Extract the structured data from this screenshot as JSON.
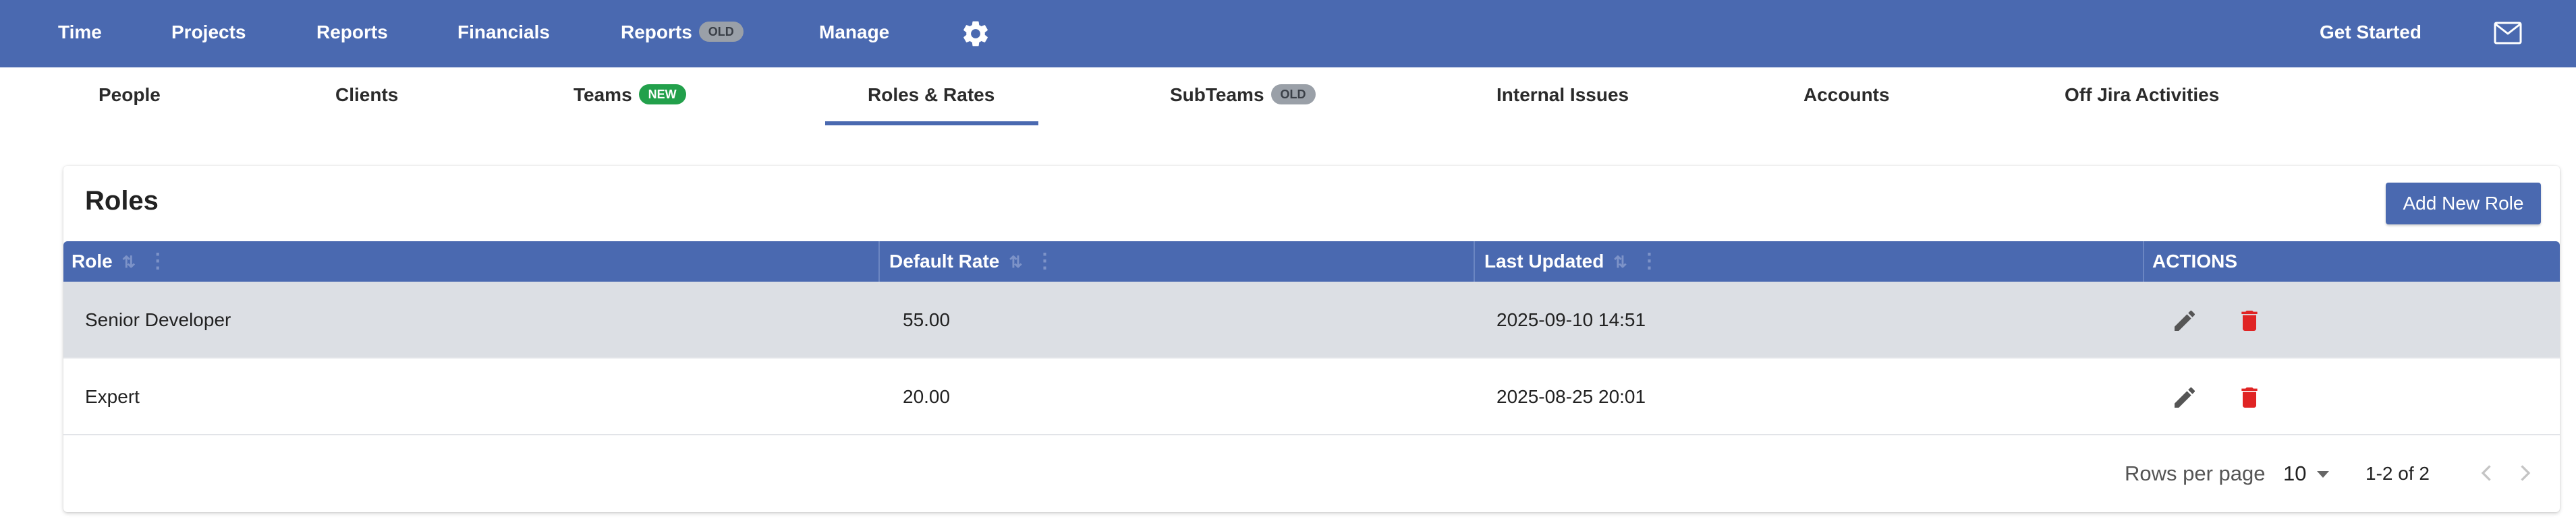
{
  "topnav": {
    "items": [
      {
        "label": "Time"
      },
      {
        "label": "Projects"
      },
      {
        "label": "Reports"
      },
      {
        "label": "Financials"
      },
      {
        "label": "Reports",
        "badge": "OLD"
      },
      {
        "label": "Manage"
      }
    ],
    "get_started": "Get Started",
    "settings_icon": "gear-icon",
    "mail_icon": "mail-icon"
  },
  "subnav": {
    "tabs": [
      {
        "label": "People"
      },
      {
        "label": "Clients"
      },
      {
        "label": "Teams",
        "badge": "NEW"
      },
      {
        "label": "Roles & Rates",
        "active": true
      },
      {
        "label": "SubTeams",
        "badge": "OLD"
      },
      {
        "label": "Internal Issues"
      },
      {
        "label": "Accounts"
      },
      {
        "label": "Off Jira Activities"
      }
    ]
  },
  "card": {
    "title": "Roles",
    "add_button": "Add New Role"
  },
  "table": {
    "columns": [
      {
        "label": "Role",
        "sortable": true
      },
      {
        "label": "Default Rate",
        "sortable": true
      },
      {
        "label": "Last Updated",
        "sortable": true
      },
      {
        "label": "ACTIONS",
        "sortable": false
      }
    ],
    "rows": [
      {
        "role": "Senior Developer",
        "rate": "55.00",
        "updated": "2025-09-10 14:51"
      },
      {
        "role": "Expert",
        "rate": "20.00",
        "updated": "2025-08-25 20:01"
      }
    ]
  },
  "pagination": {
    "rows_per_page_label": "Rows per page",
    "rows_per_page": "10",
    "range": "1-2 of 2"
  },
  "colors": {
    "brand": "#4a69b0",
    "delete": "#e02424",
    "badge_new": "#22a04b",
    "badge_old": "#9aa0a8",
    "selected_row": "#dcdfe4"
  }
}
